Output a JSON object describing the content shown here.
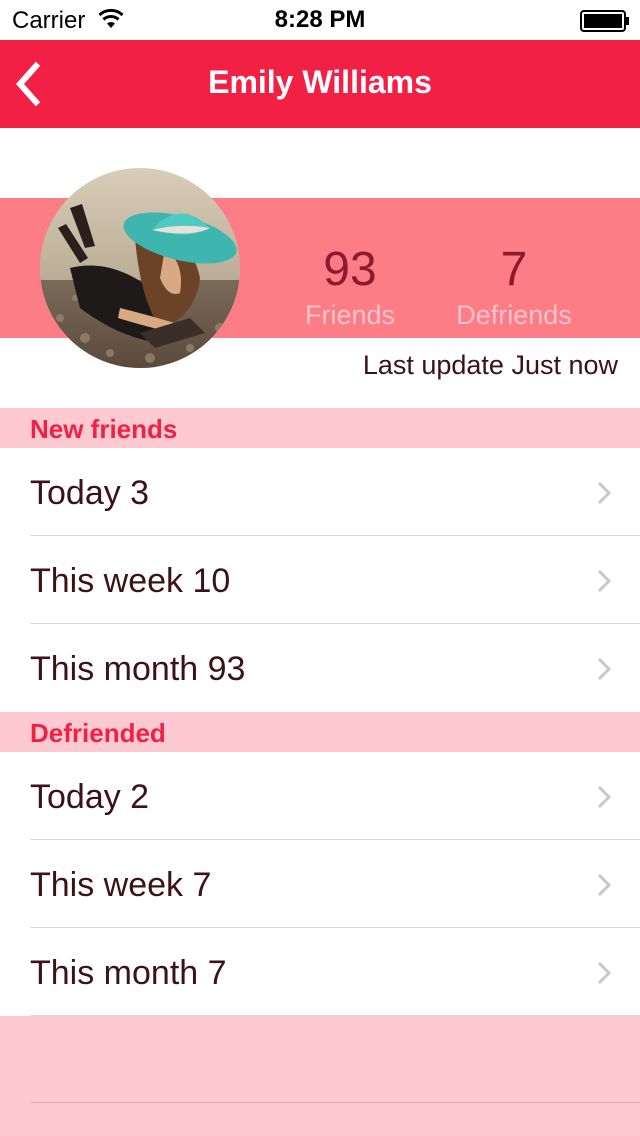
{
  "status_bar": {
    "carrier": "Carrier",
    "time": "8:28 PM",
    "wifi_icon": "wifi-icon",
    "battery_icon": "battery-icon"
  },
  "nav": {
    "title": "Emily Williams",
    "back_icon": "chevron-left-icon",
    "background": "#f32046"
  },
  "profile": {
    "avatar": "avatar",
    "friends_count": "93",
    "friends_label": "Friends",
    "defriends_count": "7",
    "defriends_label": "Defriends",
    "last_update": "Last update Just now",
    "band_color": "#fd7d86"
  },
  "sections": [
    {
      "title": "New friends",
      "rows": [
        {
          "label": "Today 3"
        },
        {
          "label": "This week 10"
        },
        {
          "label": "This month 93"
        }
      ]
    },
    {
      "title": "Defriended",
      "rows": [
        {
          "label": "Today 2"
        },
        {
          "label": "This week 7"
        },
        {
          "label": "This month 7"
        }
      ]
    }
  ],
  "colors": {
    "accent": "#f32046",
    "section_bg": "#fec9d0",
    "text_dark": "#3a1218"
  }
}
